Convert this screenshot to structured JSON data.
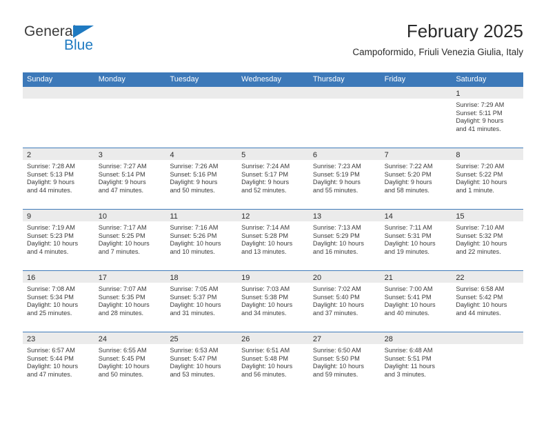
{
  "brand": {
    "name_part1": "General",
    "name_part2": "Blue",
    "accent_color": "#1f7ac1"
  },
  "header": {
    "month_title": "February 2025",
    "location": "Campoformido, Friuli Venezia Giulia, Italy"
  },
  "calendar": {
    "header_color": "#3d79b9",
    "weekdays": [
      "Sunday",
      "Monday",
      "Tuesday",
      "Wednesday",
      "Thursday",
      "Friday",
      "Saturday"
    ],
    "weeks": [
      [
        {
          "day": "",
          "lines": []
        },
        {
          "day": "",
          "lines": []
        },
        {
          "day": "",
          "lines": []
        },
        {
          "day": "",
          "lines": []
        },
        {
          "day": "",
          "lines": []
        },
        {
          "day": "",
          "lines": []
        },
        {
          "day": "1",
          "lines": [
            "Sunrise: 7:29 AM",
            "Sunset: 5:11 PM",
            "Daylight: 9 hours",
            "and 41 minutes."
          ]
        }
      ],
      [
        {
          "day": "2",
          "lines": [
            "Sunrise: 7:28 AM",
            "Sunset: 5:13 PM",
            "Daylight: 9 hours",
            "and 44 minutes."
          ]
        },
        {
          "day": "3",
          "lines": [
            "Sunrise: 7:27 AM",
            "Sunset: 5:14 PM",
            "Daylight: 9 hours",
            "and 47 minutes."
          ]
        },
        {
          "day": "4",
          "lines": [
            "Sunrise: 7:26 AM",
            "Sunset: 5:16 PM",
            "Daylight: 9 hours",
            "and 50 minutes."
          ]
        },
        {
          "day": "5",
          "lines": [
            "Sunrise: 7:24 AM",
            "Sunset: 5:17 PM",
            "Daylight: 9 hours",
            "and 52 minutes."
          ]
        },
        {
          "day": "6",
          "lines": [
            "Sunrise: 7:23 AM",
            "Sunset: 5:19 PM",
            "Daylight: 9 hours",
            "and 55 minutes."
          ]
        },
        {
          "day": "7",
          "lines": [
            "Sunrise: 7:22 AM",
            "Sunset: 5:20 PM",
            "Daylight: 9 hours",
            "and 58 minutes."
          ]
        },
        {
          "day": "8",
          "lines": [
            "Sunrise: 7:20 AM",
            "Sunset: 5:22 PM",
            "Daylight: 10 hours",
            "and 1 minute."
          ]
        }
      ],
      [
        {
          "day": "9",
          "lines": [
            "Sunrise: 7:19 AM",
            "Sunset: 5:23 PM",
            "Daylight: 10 hours",
            "and 4 minutes."
          ]
        },
        {
          "day": "10",
          "lines": [
            "Sunrise: 7:17 AM",
            "Sunset: 5:25 PM",
            "Daylight: 10 hours",
            "and 7 minutes."
          ]
        },
        {
          "day": "11",
          "lines": [
            "Sunrise: 7:16 AM",
            "Sunset: 5:26 PM",
            "Daylight: 10 hours",
            "and 10 minutes."
          ]
        },
        {
          "day": "12",
          "lines": [
            "Sunrise: 7:14 AM",
            "Sunset: 5:28 PM",
            "Daylight: 10 hours",
            "and 13 minutes."
          ]
        },
        {
          "day": "13",
          "lines": [
            "Sunrise: 7:13 AM",
            "Sunset: 5:29 PM",
            "Daylight: 10 hours",
            "and 16 minutes."
          ]
        },
        {
          "day": "14",
          "lines": [
            "Sunrise: 7:11 AM",
            "Sunset: 5:31 PM",
            "Daylight: 10 hours",
            "and 19 minutes."
          ]
        },
        {
          "day": "15",
          "lines": [
            "Sunrise: 7:10 AM",
            "Sunset: 5:32 PM",
            "Daylight: 10 hours",
            "and 22 minutes."
          ]
        }
      ],
      [
        {
          "day": "16",
          "lines": [
            "Sunrise: 7:08 AM",
            "Sunset: 5:34 PM",
            "Daylight: 10 hours",
            "and 25 minutes."
          ]
        },
        {
          "day": "17",
          "lines": [
            "Sunrise: 7:07 AM",
            "Sunset: 5:35 PM",
            "Daylight: 10 hours",
            "and 28 minutes."
          ]
        },
        {
          "day": "18",
          "lines": [
            "Sunrise: 7:05 AM",
            "Sunset: 5:37 PM",
            "Daylight: 10 hours",
            "and 31 minutes."
          ]
        },
        {
          "day": "19",
          "lines": [
            "Sunrise: 7:03 AM",
            "Sunset: 5:38 PM",
            "Daylight: 10 hours",
            "and 34 minutes."
          ]
        },
        {
          "day": "20",
          "lines": [
            "Sunrise: 7:02 AM",
            "Sunset: 5:40 PM",
            "Daylight: 10 hours",
            "and 37 minutes."
          ]
        },
        {
          "day": "21",
          "lines": [
            "Sunrise: 7:00 AM",
            "Sunset: 5:41 PM",
            "Daylight: 10 hours",
            "and 40 minutes."
          ]
        },
        {
          "day": "22",
          "lines": [
            "Sunrise: 6:58 AM",
            "Sunset: 5:42 PM",
            "Daylight: 10 hours",
            "and 44 minutes."
          ]
        }
      ],
      [
        {
          "day": "23",
          "lines": [
            "Sunrise: 6:57 AM",
            "Sunset: 5:44 PM",
            "Daylight: 10 hours",
            "and 47 minutes."
          ]
        },
        {
          "day": "24",
          "lines": [
            "Sunrise: 6:55 AM",
            "Sunset: 5:45 PM",
            "Daylight: 10 hours",
            "and 50 minutes."
          ]
        },
        {
          "day": "25",
          "lines": [
            "Sunrise: 6:53 AM",
            "Sunset: 5:47 PM",
            "Daylight: 10 hours",
            "and 53 minutes."
          ]
        },
        {
          "day": "26",
          "lines": [
            "Sunrise: 6:51 AM",
            "Sunset: 5:48 PM",
            "Daylight: 10 hours",
            "and 56 minutes."
          ]
        },
        {
          "day": "27",
          "lines": [
            "Sunrise: 6:50 AM",
            "Sunset: 5:50 PM",
            "Daylight: 10 hours",
            "and 59 minutes."
          ]
        },
        {
          "day": "28",
          "lines": [
            "Sunrise: 6:48 AM",
            "Sunset: 5:51 PM",
            "Daylight: 11 hours",
            "and 3 minutes."
          ]
        },
        {
          "day": "",
          "lines": []
        }
      ]
    ]
  }
}
